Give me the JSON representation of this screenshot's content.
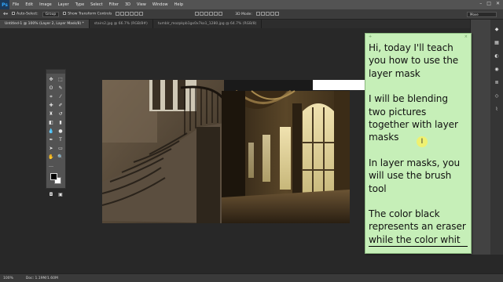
{
  "app": {
    "logo": "Ps"
  },
  "menubar": {
    "items": [
      {
        "label": "File"
      },
      {
        "label": "Edit"
      },
      {
        "label": "Image"
      },
      {
        "label": "Layer"
      },
      {
        "label": "Type"
      },
      {
        "label": "Select"
      },
      {
        "label": "Filter"
      },
      {
        "label": "3D"
      },
      {
        "label": "View"
      },
      {
        "label": "Window"
      },
      {
        "label": "Help"
      }
    ]
  },
  "options": {
    "auto_select_label": "Auto-Select:",
    "auto_select_value": "Group",
    "transform_label": "Show Transform Controls",
    "mode_label": "3D Mode:",
    "workspace": "Move"
  },
  "tabs": [
    {
      "label": "Untitled-1 @ 100% (Layer 2, Layer Mask/8) *",
      "active": true
    },
    {
      "label": "stairs2.jpg @ 66.7% (RGB/8#)",
      "active": false
    },
    {
      "label": "tumblr_mozpkpb1gx0x7ko1_1280.jpg @ 64.7% (RGB/8)",
      "active": false
    }
  ],
  "note": {
    "paragraphs": [
      "Hi, today I'll teach you how to use the layer mask",
      "I will be blending two pictures together with layer masks",
      "In layer masks, you will use the brush tool",
      "The color black represents an eraser while the color whit"
    ]
  },
  "status": {
    "zoom": "100%",
    "doc": "Doc: 1.19M/1.60M"
  },
  "colors": {
    "foreground": "#000000",
    "background": "#ffffff",
    "note_bg": "#c6efb8"
  }
}
